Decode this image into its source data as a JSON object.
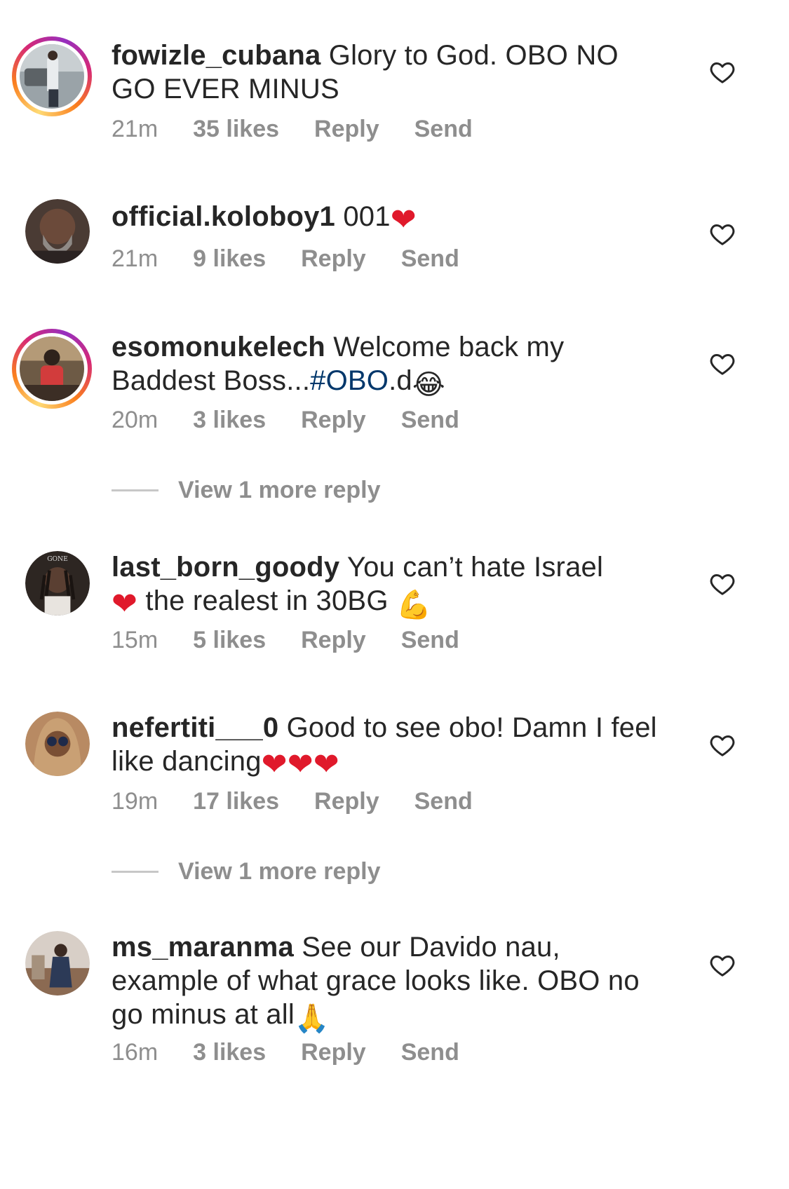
{
  "comments": [
    {
      "username": "fowizle_cubana",
      "text": "Glory to God. OBO NO GO EVER MINUS",
      "time": "21m",
      "likes": "35 likes",
      "reply": "Reply",
      "send": "Send",
      "avatar_story_ring": true
    },
    {
      "username": "official.koloboy1",
      "text": "001",
      "emoji": "❤",
      "time": "21m",
      "likes": "9 likes",
      "reply": "Reply",
      "send": "Send",
      "avatar_story_ring": false
    },
    {
      "username": "esomonukelech",
      "text": "Welcome back my Baddest Boss...",
      "hashtag": "#OBO",
      "text_after": ".d",
      "emoji": "😂",
      "time": "20m",
      "likes": "3 likes",
      "reply": "Reply",
      "send": "Send",
      "avatar_story_ring": true
    },
    {
      "username": "last_born_goody",
      "text": "You can’t hate Israel",
      "emoji_mid": "❤",
      "text_after": "the realest in 30BG",
      "emoji": "💪",
      "time": "15m",
      "likes": "5 likes",
      "reply": "Reply",
      "send": "Send",
      "avatar_story_ring": false
    },
    {
      "username": "nefertiti___0",
      "text": "Good to see obo! Damn I feel like dancing",
      "emoji": "❤❤❤",
      "time": "19m",
      "likes": "17 likes",
      "reply": "Reply",
      "send": "Send",
      "avatar_story_ring": false
    },
    {
      "username": "ms_maranma",
      "text": "See our Davido nau, example of what grace looks like. OBO no go minus at all",
      "emoji": "🙏",
      "time": "16m",
      "likes": "3 likes",
      "reply": "Reply",
      "send": "Send",
      "avatar_story_ring": false
    }
  ],
  "view_more": [
    {
      "label": "View 1 more reply"
    },
    {
      "label": "View 1 more reply"
    }
  ],
  "icons": {
    "like": "heart-outline-icon"
  },
  "colors": {
    "text": "#262626",
    "meta": "#8e8e8e",
    "hashtag": "#00376b",
    "heart": "#e0192b"
  }
}
